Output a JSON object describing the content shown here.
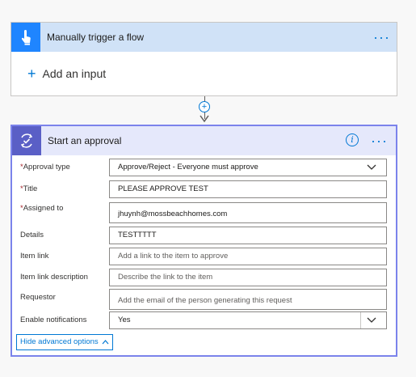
{
  "trigger": {
    "title": "Manually trigger a flow",
    "more": "···",
    "add_input_plus": "+",
    "add_input_label": "Add an input"
  },
  "connector": {
    "plus": "+"
  },
  "approval": {
    "title": "Start an approval",
    "info": "i",
    "more": "···",
    "fields": {
      "approval_type": {
        "label": "Approval type",
        "required": "*",
        "value": "Approve/Reject - Everyone must approve"
      },
      "title": {
        "label": "Title",
        "required": "*",
        "value": "PLEASE APPROVE TEST"
      },
      "assigned_to": {
        "label": "Assigned to",
        "required": "*",
        "value": "jhuynh@mossbeachhomes.com"
      },
      "details": {
        "label": "Details",
        "value": "TESTTTTT"
      },
      "item_link": {
        "label": "Item link",
        "placeholder": "Add a link to the item to approve"
      },
      "item_link_description": {
        "label": "Item link description",
        "placeholder": "Describe the link to the item"
      },
      "requestor": {
        "label": "Requestor",
        "placeholder": "Add the email of the person generating this request"
      },
      "enable_notifications": {
        "label": "Enable notifications",
        "value": "Yes"
      }
    },
    "hide_advanced_label": "Hide advanced options"
  },
  "colors": {
    "trigger_accent": "#1f85ff",
    "approval_accent": "#5a5fc6",
    "link_blue": "#0078d4",
    "required_red": "#a4262c"
  },
  "icons": [
    "hand-touch-icon",
    "approval-check-icon",
    "info-icon",
    "more-icon",
    "plus-icon",
    "chevron-down-icon",
    "chevron-up-icon",
    "arrow-down-icon"
  ]
}
